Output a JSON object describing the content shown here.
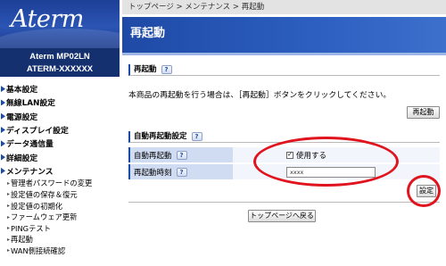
{
  "sidebar": {
    "logo_text": "Aterm",
    "model_line1": "Aterm   MP02LN",
    "model_line2": "ATERM-XXXXXX",
    "items": [
      {
        "label": "基本設定"
      },
      {
        "label": "無線LAN設定"
      },
      {
        "label": "電源設定"
      },
      {
        "label": "ディスプレイ設定"
      },
      {
        "label": "データ通信量"
      },
      {
        "label": "詳細設定"
      },
      {
        "label": "メンテナンス"
      }
    ],
    "sub_items": [
      {
        "label": "管理者パスワードの変更"
      },
      {
        "label": "設定値の保存＆復元"
      },
      {
        "label": "設定値の初期化"
      },
      {
        "label": "ファームウェア更新"
      },
      {
        "label": "PINGテスト"
      },
      {
        "label": "再起動"
      },
      {
        "label": "WAN側接続確認"
      }
    ]
  },
  "breadcrumb": "トップページ > メンテナンス > 再起動",
  "page_title": "再起動",
  "section_restart": {
    "heading": "再起動",
    "help": "?",
    "description": "本商品の再起動を行う場合は、［再起動］ボタンをクリックしてください。",
    "button": "再起動"
  },
  "section_auto": {
    "heading": "自動再起動設定",
    "help": "?",
    "rows": [
      {
        "label": "自動再起動",
        "help": "?",
        "checkbox_label": "使用する",
        "checked": true
      },
      {
        "label": "再起動時刻",
        "help": "?",
        "input_value": "xxxx"
      }
    ],
    "set_button": "設定"
  },
  "back_button": "トップページへ戻る",
  "colors": {
    "accent": "#1a4ba8",
    "annotation": "#e0141e"
  }
}
